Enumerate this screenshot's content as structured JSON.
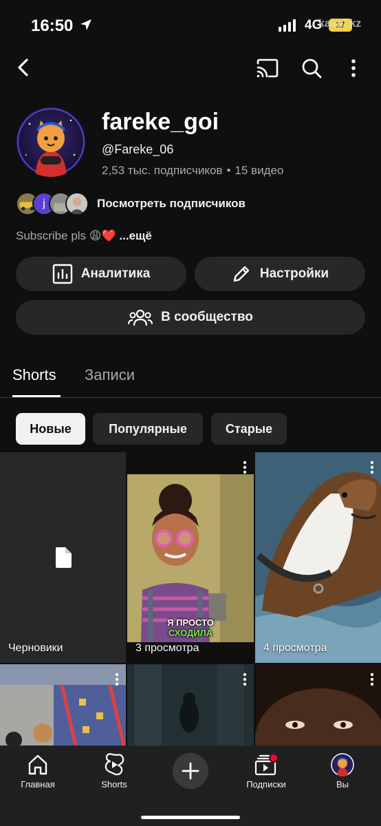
{
  "status_bar": {
    "time": "16:50",
    "network": "4G",
    "battery": "17",
    "watermark": "kaspi.kz"
  },
  "top_bar": {
    "icons": [
      "back-icon",
      "cast-icon",
      "search-icon",
      "more-vertical-icon"
    ]
  },
  "channel": {
    "name": "fareke_goi",
    "handle": "@Fareke_06",
    "subscribers": "2,53 тыс. подписчиков",
    "separator": "•",
    "videos": "15 видео",
    "view_subscribers_label": "Посмотреть подписчиков",
    "subscriber_avatar_letter": "j",
    "description": "Subscribe pls 😩❤️",
    "more_label": "...ещё"
  },
  "actions": {
    "analytics_label": "Аналитика",
    "settings_label": "Настройки",
    "community_label": "В сообщество"
  },
  "tabs": [
    {
      "label": "Shorts",
      "active": true
    },
    {
      "label": "Записи",
      "active": false
    }
  ],
  "filters": [
    {
      "label": "Новые",
      "selected": true
    },
    {
      "label": "Популярные",
      "selected": false
    },
    {
      "label": "Старые",
      "selected": false
    }
  ],
  "grid": {
    "drafts_label": "Черновики",
    "items": [
      {
        "views": "3 просмотра",
        "caption_line1": "Я ПРОСТО",
        "caption_line2": "СХОДИЛА"
      },
      {
        "views": "4 просмотра"
      }
    ]
  },
  "bottom_nav": [
    {
      "label": "Главная",
      "icon": "home-icon"
    },
    {
      "label": "Shorts",
      "icon": "shorts-icon"
    },
    {
      "label": "",
      "icon": "create-plus-icon"
    },
    {
      "label": "Подписки",
      "icon": "subscriptions-icon"
    },
    {
      "label": "Вы",
      "icon": "profile-avatar"
    }
  ],
  "colors": {
    "background": "#0f0f0f",
    "button_bg": "#272727",
    "secondary_text": "#aaaaaa",
    "notification_dot": "#ff0033"
  }
}
